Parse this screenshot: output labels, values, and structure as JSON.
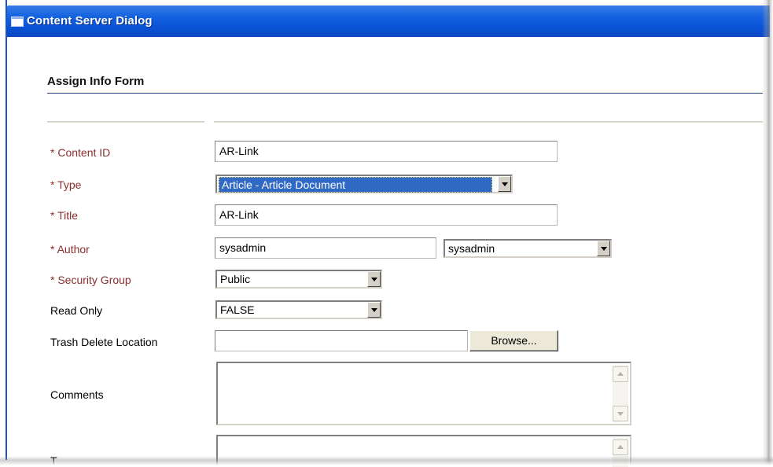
{
  "window": {
    "title": "Content Server Dialog"
  },
  "form": {
    "heading": "Assign Info Form",
    "fields": {
      "content_id": {
        "label": "* Content ID",
        "value": "AR-Link"
      },
      "type": {
        "label": "* Type",
        "value": "Article - Article Document"
      },
      "title": {
        "label": "* Title",
        "value": "AR-Link"
      },
      "author": {
        "label": "* Author",
        "value": "sysadmin",
        "select_value": "sysadmin"
      },
      "security_group": {
        "label": "* Security Group",
        "value": "Public"
      },
      "read_only": {
        "label": "Read Only",
        "value": "FALSE"
      },
      "trash_delete_location": {
        "label": "Trash Delete Location",
        "value": "",
        "browse_label": "Browse..."
      },
      "comments": {
        "label": "Comments",
        "value": ""
      },
      "next_field": {
        "label": "T"
      }
    }
  },
  "icons": [
    "app-window-icon",
    "dropdown-arrow-icon",
    "scroll-up-icon",
    "scroll-down-icon"
  ]
}
